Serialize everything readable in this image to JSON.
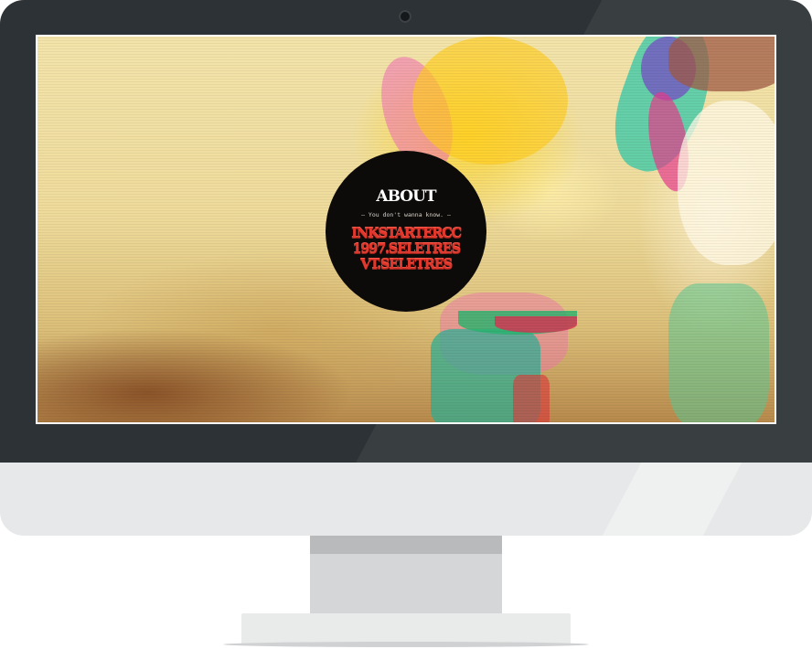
{
  "about": {
    "title": "ABOUT",
    "subtitle": "— You don't wanna know. —",
    "lines": [
      "INKSTARTERCC",
      "1997.SELETRES",
      "VT.SELETRES"
    ]
  },
  "colors": {
    "bezel": "#2d3236",
    "chin": "#e7e8e9",
    "badge": "#0d0b0a",
    "accent_red": "#e1372c",
    "screen_bg": "#ecd89a"
  }
}
